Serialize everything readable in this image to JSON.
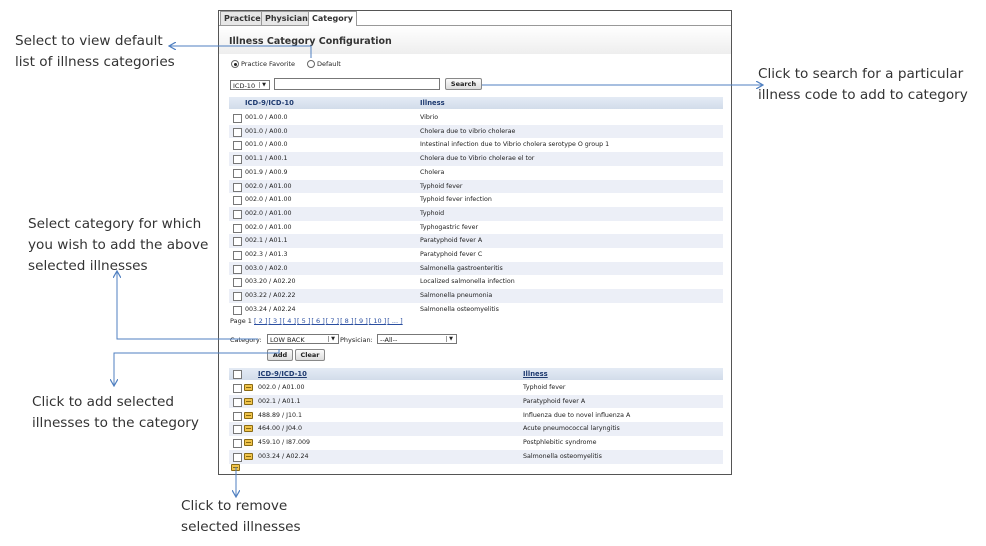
{
  "tabs": [
    "Practice",
    "Physician",
    "Category"
  ],
  "active_tab": "Category",
  "panel": {
    "title": "Illness Category Configuration",
    "radio_practice_favorite": "Practice Favorite",
    "radio_default": "Default",
    "selected_radio": "Practice Favorite",
    "code_type_value": "ICD-10",
    "search_value": "",
    "search_button": "Search"
  },
  "table1": {
    "col_code": "ICD-9/ICD-10",
    "col_illness": "Illness",
    "rows": [
      {
        "code": "001.0 / A00.0",
        "illness": "Vibrio"
      },
      {
        "code": "001.0 / A00.0",
        "illness": "Cholera due to vibrio cholerae"
      },
      {
        "code": "001.0 / A00.0",
        "illness": "Intestinal infection due to Vibrio cholera serotype O group 1"
      },
      {
        "code": "001.1 / A00.1",
        "illness": "Cholera due to Vibrio cholerae el tor"
      },
      {
        "code": "001.9 / A00.9",
        "illness": "Cholera"
      },
      {
        "code": "002.0 / A01.00",
        "illness": "Typhoid fever"
      },
      {
        "code": "002.0 / A01.00",
        "illness": "Typhoid fever infection"
      },
      {
        "code": "002.0 / A01.00",
        "illness": "Typhoid"
      },
      {
        "code": "002.0 / A01.00",
        "illness": "Typhogastric fever"
      },
      {
        "code": "002.1 / A01.1",
        "illness": "Paratyphoid fever A"
      },
      {
        "code": "002.3 / A01.3",
        "illness": "Paratyphoid fever C"
      },
      {
        "code": "003.0 / A02.0",
        "illness": "Salmonella gastroenteritis"
      },
      {
        "code": "003.20 / A02.20",
        "illness": "Localized salmonella infection"
      },
      {
        "code": "003.22 / A02.22",
        "illness": "Salmonella pneumonia"
      },
      {
        "code": "003.24 / A02.24",
        "illness": "Salmonella osteomyelitis"
      }
    ]
  },
  "pager": {
    "label": "Page 1",
    "links": [
      "[ 2 ]",
      "[ 3 ]",
      "[ 4 ]",
      "[ 5 ]",
      "[ 6 ]",
      "[ 7 ]",
      "[ 8 ]",
      "[ 9 ]",
      "[ 10 ]",
      "[ ... ]"
    ]
  },
  "filters": {
    "category_label": "Category:",
    "category_value": "LOW BACK",
    "physician_label": "Physician:",
    "physician_value": "--All--",
    "add_button": "Add",
    "clear_button": "Clear"
  },
  "table2": {
    "col_code": "ICD-9/ICD-10",
    "col_illness": "Illness",
    "rows": [
      {
        "code": "002.0 / A01.00",
        "illness": "Typhoid fever"
      },
      {
        "code": "002.1 / A01.1",
        "illness": "Paratyphoid fever A"
      },
      {
        "code": "488.89 / J10.1",
        "illness": "Influenza due to novel influenza A"
      },
      {
        "code": "464.00 / J04.0",
        "illness": "Acute pneumococcal laryngitis"
      },
      {
        "code": "459.10 / I87.009",
        "illness": "Postphlebitic syndrome"
      },
      {
        "code": "003.24 / A02.24",
        "illness": "Salmonella osteomyelitis"
      }
    ]
  },
  "annotations": {
    "default_list": [
      "Select to view default",
      "list of illness categories"
    ],
    "search": [
      "Click to search for a particular",
      "illness code to add to category"
    ],
    "category": [
      "Select category for which",
      "you wish to add the above",
      "selected illnesses"
    ],
    "add": [
      "Click to add selected",
      "illnesses to the category"
    ],
    "remove": [
      "Click to remove",
      "selected illnesses"
    ]
  },
  "colors": {
    "header_text": "#1f3b70",
    "row_alt": "#eceff7",
    "arrow": "#4f7fc0"
  }
}
